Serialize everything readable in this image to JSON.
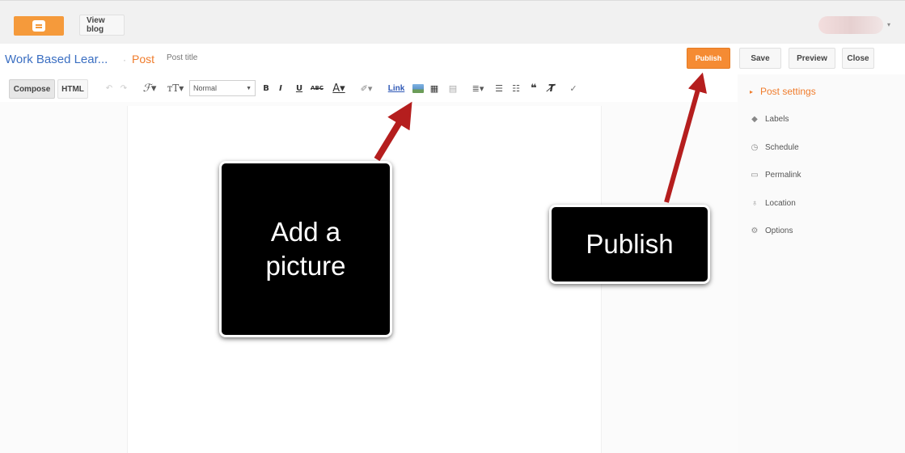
{
  "header": {
    "view_blog_label": "View blog"
  },
  "titlebar": {
    "blog_title": "Work Based Lear...",
    "separator": "·",
    "crumb": "Post",
    "post_title_placeholder": "Post title",
    "publish_label": "Publish",
    "save_label": "Save",
    "preview_label": "Preview",
    "close_label": "Close"
  },
  "toolbar": {
    "compose_label": "Compose",
    "html_label": "HTML",
    "format_value": "Normal",
    "link_label": "Link",
    "icons": [
      "undo-icon",
      "redo-icon",
      "font-family-icon",
      "font-size-icon",
      "bold-icon",
      "italic-icon",
      "underline-icon",
      "strikethrough-icon",
      "text-color-icon",
      "highlight-icon",
      "insert-image-icon",
      "insert-video-icon",
      "jump-break-icon",
      "align-icon",
      "numbered-list-icon",
      "bulleted-list-icon",
      "quote-icon",
      "remove-formatting-icon",
      "spellcheck-icon"
    ]
  },
  "sidebar": {
    "post_settings_label": "Post settings",
    "items": [
      {
        "label": "Labels",
        "icon": "tag-icon"
      },
      {
        "label": "Schedule",
        "icon": "clock-icon"
      },
      {
        "label": "Permalink",
        "icon": "link-icon"
      },
      {
        "label": "Location",
        "icon": "pin-icon"
      },
      {
        "label": "Options",
        "icon": "gear-icon"
      }
    ]
  },
  "annotations": {
    "add_picture": "Add a picture",
    "publish": "Publish"
  },
  "colors": {
    "accent_orange": "#f58b33",
    "title_blue": "#3b6fc2",
    "arrow_red": "#b51e1e",
    "callout_black": "#000000"
  }
}
